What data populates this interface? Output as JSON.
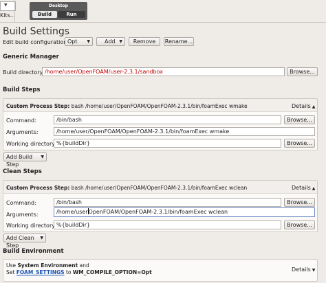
{
  "kit_selector": {
    "label": "Kits..."
  },
  "mode": {
    "title": "Desktop",
    "tabs": [
      {
        "label": "Build"
      },
      {
        "label": "Run"
      }
    ]
  },
  "page": {
    "title": "Build Settings"
  },
  "config": {
    "label": "Edit build configuration:",
    "selected": "Opt",
    "add_label": "Add",
    "remove_label": "Remove",
    "rename_label": "Rename..."
  },
  "generic": {
    "heading": "Generic Manager",
    "dir_label": "Build directory:",
    "dir_value": "/home/user/OpenFOAM/user-2.3.1/sandbox",
    "browse_label": "Browse..."
  },
  "build_steps": {
    "heading": "Build Steps",
    "step_prefix": "Custom Process Step:",
    "step_cmd": "bash /home/user/OpenFOAM/OpenFOAM-2.3.1/bin/foamExec wmake",
    "details_label": "Details",
    "command_label": "Command:",
    "command_value": "/bin/bash",
    "arguments_label": "Arguments:",
    "arguments_value": "/home/user/OpenFOAM/OpenFOAM-2.3.1/bin/foamExec wmake",
    "workdir_label": "Working directory:",
    "workdir_value": "%{buildDir}",
    "browse_label": "Browse...",
    "add_label": "Add Build Step"
  },
  "clean_steps": {
    "heading": "Clean Steps",
    "step_prefix": "Custom Process Step:",
    "step_cmd": "bash /home/user/OpenFOAM/OpenFOAM-2.3.1/bin/foamExec wclean",
    "details_label": "Details",
    "command_label": "Command:",
    "command_value": "/bin/bash",
    "arguments_label": "Arguments:",
    "arguments_before_cursor": "/home/user",
    "arguments_after_cursor": "OpenFOAM/OpenFOAM-2.3.1/bin/foamExec wclean",
    "workdir_label": "Working directory:",
    "workdir_value": "%{buildDir}",
    "browse_label": "Browse...",
    "add_label": "Add Clean Step"
  },
  "environment": {
    "heading": "Build Environment",
    "line1_prefix": "Use",
    "line1_bold": "System Environment",
    "line1_suffix": "and",
    "line2_prefix": "Set",
    "line2_link": "FOAM_SETTINGS",
    "line2_mid": "to",
    "line2_bold": "WM_COMPILE_OPTION=Opt",
    "details_label": "Details"
  },
  "icons": {
    "dropdown": "chevron-down-icon",
    "collapse": "chevron-up-icon"
  }
}
